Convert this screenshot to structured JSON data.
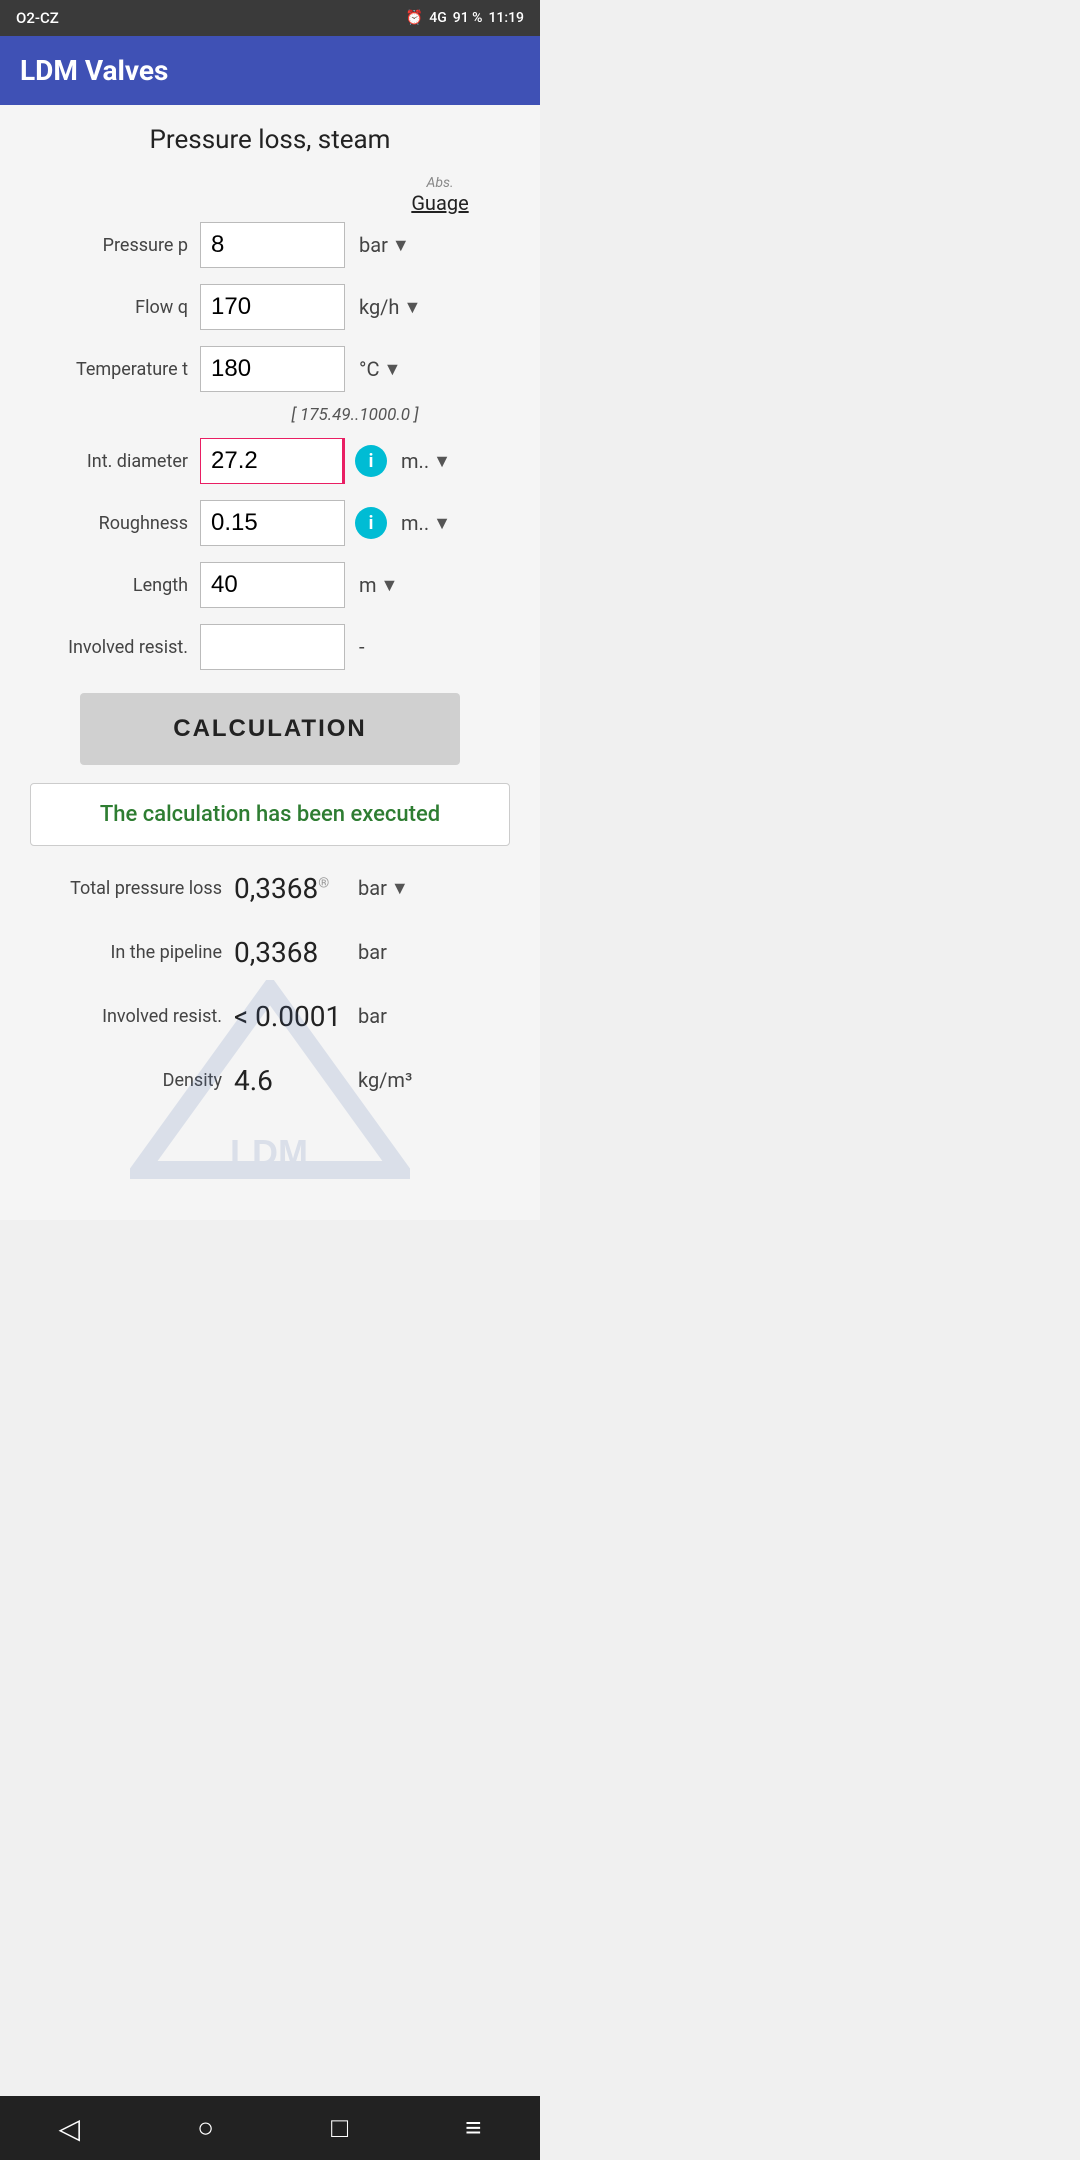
{
  "status_bar": {
    "carrier": "O2-CZ",
    "alarm_icon": "⏰",
    "signal": "4G",
    "battery": "91 %",
    "time": "11:19"
  },
  "app_bar": {
    "title": "LDM Valves"
  },
  "page": {
    "title": "Pressure loss, steam"
  },
  "pressure_type": {
    "abs_label": "Abs.",
    "gauge_label": "Guage"
  },
  "form": {
    "pressure": {
      "label": "Pressure p",
      "value": "8",
      "unit": "bar",
      "has_dropdown": true
    },
    "flow": {
      "label": "Flow q",
      "value": "170",
      "unit": "kg/h",
      "has_dropdown": true
    },
    "temperature": {
      "label": "Temperature t",
      "value": "180",
      "unit": "°C",
      "has_dropdown": true,
      "range_hint": "[ 175.49..1000.0 ]"
    },
    "int_diameter": {
      "label": "Int. diameter",
      "value": "27.2",
      "unit": "m..",
      "has_dropdown": true,
      "has_info": true
    },
    "roughness": {
      "label": "Roughness",
      "value": "0.15",
      "unit": "m..",
      "has_dropdown": true,
      "has_info": true
    },
    "length": {
      "label": "Length",
      "value": "40",
      "unit": "m",
      "has_dropdown": true
    },
    "involved_resist": {
      "label": "Involved resist.",
      "value": "",
      "unit": "-",
      "has_dropdown": false
    }
  },
  "calculation_button": {
    "label": "CALCULATION"
  },
  "result_message": "The calculation has been executed",
  "results": {
    "total_pressure_loss": {
      "label": "Total pressure loss",
      "value": "0,3368",
      "unit": "bar",
      "has_dropdown": true,
      "has_reg": true
    },
    "in_pipeline": {
      "label": "In the pipeline",
      "value": "0,3368",
      "unit": "bar"
    },
    "involved_resist": {
      "label": "Involved resist.",
      "value": "< 0.0001",
      "unit": "bar"
    },
    "density": {
      "label": "Density",
      "value": "4.6",
      "unit": "kg/m³"
    }
  },
  "nav_bar": {
    "back": "◁",
    "home": "○",
    "recent": "□",
    "menu": "≡"
  }
}
